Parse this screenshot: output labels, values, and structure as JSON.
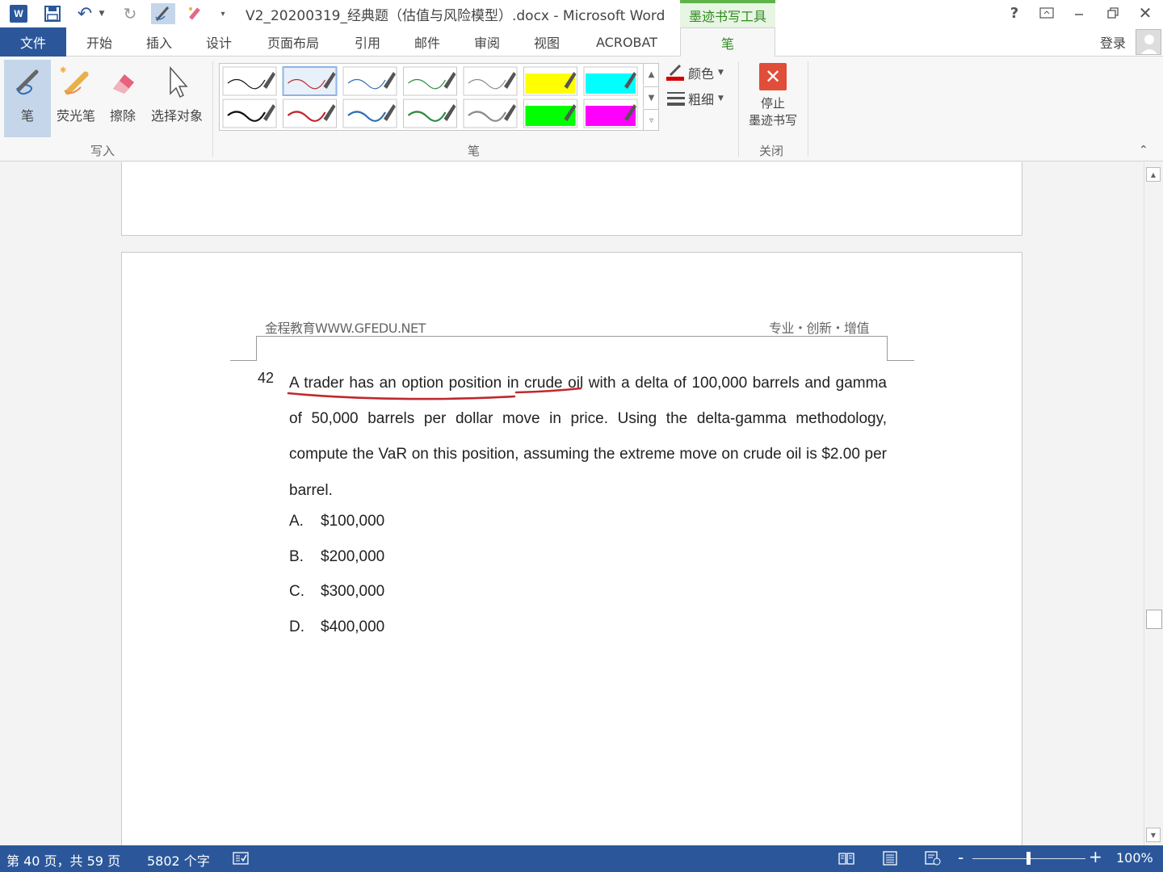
{
  "window": {
    "title": "V2_20200319_经典题（估值与风险模型）.docx - Microsoft Word",
    "context_tab": "墨迹书写工具",
    "help": "?",
    "close": "✕"
  },
  "tabs": {
    "file": "文件",
    "items": [
      "开始",
      "插入",
      "设计",
      "页面布局",
      "引用",
      "邮件",
      "审阅",
      "视图",
      "ACROBAT",
      "笔"
    ],
    "signin": "登录"
  },
  "ribbon": {
    "write_group": {
      "label": "写入",
      "pen": "笔",
      "highlighter": "荧光笔",
      "eraser": "擦除",
      "select": "选择对象"
    },
    "pens_group": {
      "label": "笔",
      "color": "颜色",
      "thickness": "粗细",
      "swatches": [
        {
          "row": 1,
          "type": "pen",
          "color": "#111111",
          "selected": false
        },
        {
          "row": 1,
          "type": "pen",
          "color": "#c0282d",
          "selected": true
        },
        {
          "row": 1,
          "type": "pen",
          "color": "#2e6fb5",
          "selected": false
        },
        {
          "row": 1,
          "type": "pen",
          "color": "#2e8b3e",
          "selected": false
        },
        {
          "row": 1,
          "type": "pen",
          "color": "#8a8a8a",
          "selected": false
        },
        {
          "row": 1,
          "type": "highlighter",
          "color": "#ffff00",
          "selected": false
        },
        {
          "row": 1,
          "type": "highlighter",
          "color": "#00ffff",
          "selected": false
        },
        {
          "row": 2,
          "type": "pen",
          "color": "#111111",
          "selected": false
        },
        {
          "row": 2,
          "type": "pen",
          "color": "#c0282d",
          "selected": false
        },
        {
          "row": 2,
          "type": "pen",
          "color": "#2e6fb5",
          "selected": false
        },
        {
          "row": 2,
          "type": "pen",
          "color": "#2e8b3e",
          "selected": false
        },
        {
          "row": 2,
          "type": "pen",
          "color": "#8a8a8a",
          "selected": false
        },
        {
          "row": 2,
          "type": "highlighter",
          "color": "#00ff00",
          "selected": false
        },
        {
          "row": 2,
          "type": "highlighter",
          "color": "#ff00ff",
          "selected": false
        }
      ]
    },
    "close_group": {
      "label": "关闭",
      "stop_line1": "停止",
      "stop_line2": "墨迹书写"
    }
  },
  "document": {
    "header_left": "金程教育WWW.GFEDU.NET",
    "header_right": "专业・创新・增值",
    "question_number": "42",
    "question_text": "A trader has an option position in crude oil with a delta of 100,000 barrels and gamma of 50,000 barrels per dollar move in price. Using the delta-gamma methodology, compute the VaR on this position, assuming the extreme move on crude oil is $2.00 per barrel.",
    "options": [
      {
        "letter": "A.",
        "text": "$100,000"
      },
      {
        "letter": "B.",
        "text": "$200,000"
      },
      {
        "letter": "C.",
        "text": "$300,000"
      },
      {
        "letter": "D.",
        "text": "$400,000"
      }
    ],
    "ink_color": "#c0282d"
  },
  "status": {
    "page": "第 40 页，共 59 页",
    "words": "5802 个字",
    "zoom": "100%",
    "zoom_minus": "-",
    "zoom_plus": "+",
    "accent": "#2b579a"
  }
}
